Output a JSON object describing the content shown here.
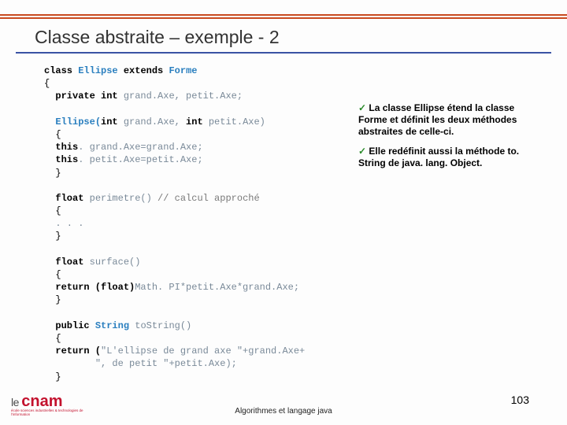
{
  "title": "Classe abstraite – exemple - 2",
  "code": {
    "l1a": "class",
    "l1b": "Ellipse",
    "l1c": "extends",
    "l1d": "Forme",
    "l2": "{",
    "l3a": "private int ",
    "l3b": "grand.Axe, petit.Axe;",
    "l5a": "Ellipse(",
    "l5b": "int ",
    "l5c": "grand.Axe, ",
    "l5d": "int ",
    "l5e": "petit.Axe)",
    "l6": "  {",
    "l7a": "  this",
    "l7b": ". grand.Axe=grand.Axe;",
    "l8a": "  this",
    "l8b": ". petit.Axe=petit.Axe;",
    "l9": "  }",
    "l11a": "float ",
    "l11b": "perimetre()",
    "l11c": " // calcul approché",
    "l12": "  {",
    "l13": "  . . .",
    "l14": "  }",
    "l16a": "float ",
    "l16b": "surface()",
    "l17": "  {",
    "l18a": "  return (float)",
    "l18b": "Math. PI*petit.Axe*grand.Axe;",
    "l19": "  }",
    "l21a": "public ",
    "l21b": "String ",
    "l21c": "toString()",
    "l22": "  {",
    "l23a": "  return (",
    "l23b": "\"L'ellipse de grand axe \"",
    "l23c": "+grand.Axe+",
    "l24a": "         ",
    "l24b": "\", de petit \"",
    "l24c": "+petit.Axe);",
    "l25": "  }"
  },
  "notes": {
    "n1": " La classe Ellipse étend la classe Forme et définit les deux méthodes abstraites de celle-ci.",
    "n2": " Elle redéfinit aussi la méthode to. String de java. lang. Object."
  },
  "logo": {
    "pre": "le ",
    "brand": "cnam",
    "sub": "école sciences industrielles & technologies de l'information"
  },
  "footer": "Algorithmes et langage java",
  "page": "103",
  "check": "✓"
}
